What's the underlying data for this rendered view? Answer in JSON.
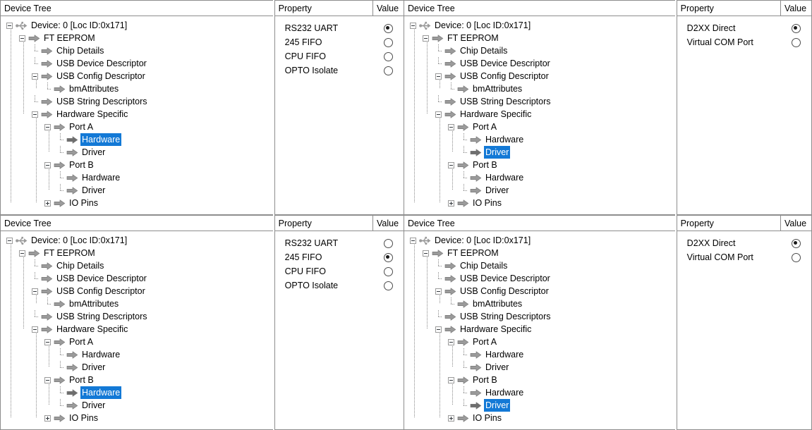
{
  "panels": {
    "tree_header": "Device Tree",
    "property_header": "Property",
    "value_header": "Value"
  },
  "colors": {
    "selection": "#1379d6",
    "selection_text": "#ffffff",
    "border": "#8d8d8d",
    "arrow_icon": "#9b9b9b",
    "arrow_icon_selected": "#6e6e6e",
    "usb_icon": "#9b9b9b",
    "text": "#000000"
  },
  "tree_nodes": [
    {
      "label": "Device: 0 [Loc ID:0x171]",
      "depth": 0,
      "icon": "usb-icon",
      "expander": "minus"
    },
    {
      "label": "FT EEPROM",
      "depth": 1,
      "icon": "arrow-icon",
      "expander": "minus"
    },
    {
      "label": "Chip Details",
      "depth": 2,
      "icon": "arrow-icon",
      "expander": "leaf"
    },
    {
      "label": "USB Device Descriptor",
      "depth": 2,
      "icon": "arrow-icon",
      "expander": "leaf"
    },
    {
      "label": "USB Config Descriptor",
      "depth": 2,
      "icon": "arrow-icon",
      "expander": "minus"
    },
    {
      "label": "bmAttributes",
      "depth": 3,
      "icon": "arrow-icon",
      "expander": "leaf"
    },
    {
      "label": "USB String Descriptors",
      "depth": 2,
      "icon": "arrow-icon",
      "expander": "leaf"
    },
    {
      "label": "Hardware Specific",
      "depth": 2,
      "icon": "arrow-icon",
      "expander": "minus"
    },
    {
      "label": "Port A",
      "depth": 3,
      "icon": "arrow-icon",
      "expander": "minus"
    },
    {
      "label": "Hardware",
      "depth": 4,
      "icon": "arrow-icon",
      "expander": "leaf"
    },
    {
      "label": "Driver",
      "depth": 4,
      "icon": "arrow-icon",
      "expander": "leaf"
    },
    {
      "label": "Port B",
      "depth": 3,
      "icon": "arrow-icon",
      "expander": "minus"
    },
    {
      "label": "Hardware",
      "depth": 4,
      "icon": "arrow-icon",
      "expander": "leaf"
    },
    {
      "label": "Driver",
      "depth": 4,
      "icon": "arrow-icon",
      "expander": "leaf"
    },
    {
      "label": "IO Pins",
      "depth": 3,
      "icon": "arrow-icon",
      "expander": "plus"
    }
  ],
  "quadrants": [
    {
      "id": "top-left",
      "selected_index": 9,
      "selected_label": "Hardware",
      "selected_port": "Port A",
      "properties": [
        {
          "name": "RS232 UART",
          "selected": true
        },
        {
          "name": "245 FIFO",
          "selected": false
        },
        {
          "name": "CPU FIFO",
          "selected": false
        },
        {
          "name": "OPTO Isolate",
          "selected": false
        }
      ]
    },
    {
      "id": "top-right",
      "selected_index": 10,
      "selected_label": "Driver",
      "selected_port": "Port A",
      "properties": [
        {
          "name": "D2XX Direct",
          "selected": true
        },
        {
          "name": "Virtual COM Port",
          "selected": false
        }
      ]
    },
    {
      "id": "bottom-left",
      "selected_index": 12,
      "selected_label": "Hardware",
      "selected_port": "Port B",
      "properties": [
        {
          "name": "RS232 UART",
          "selected": false
        },
        {
          "name": "245 FIFO",
          "selected": true
        },
        {
          "name": "CPU FIFO",
          "selected": false
        },
        {
          "name": "OPTO Isolate",
          "selected": false
        }
      ]
    },
    {
      "id": "bottom-right",
      "selected_index": 13,
      "selected_label": "Driver",
      "selected_port": "Port B",
      "properties": [
        {
          "name": "D2XX Direct",
          "selected": true
        },
        {
          "name": "Virtual COM Port",
          "selected": false
        }
      ]
    }
  ]
}
